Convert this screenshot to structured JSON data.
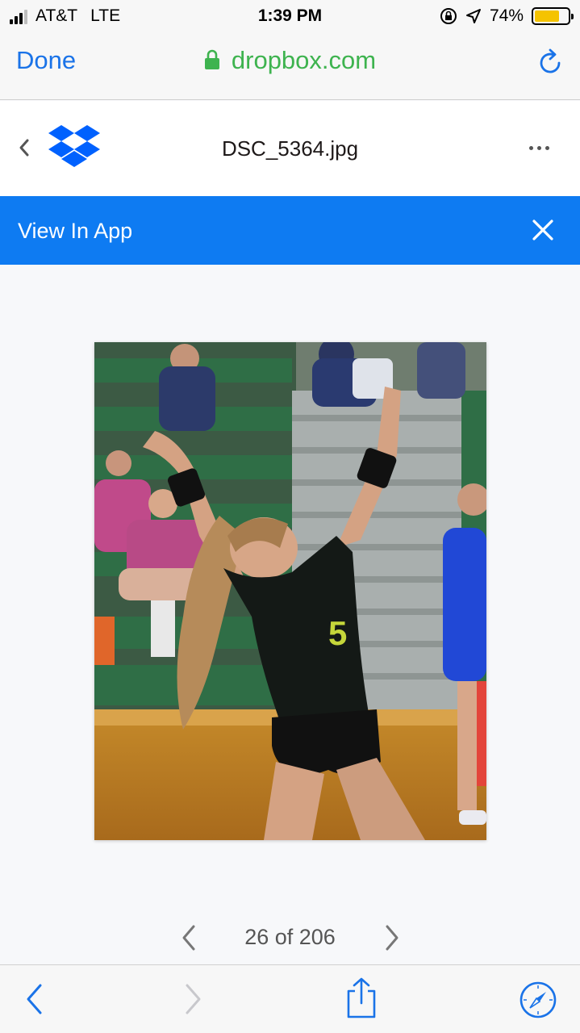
{
  "status_bar": {
    "carrier": "AT&T",
    "network": "LTE",
    "time": "1:39 PM",
    "battery_percent": "74%",
    "battery_level": 0.74,
    "icons": [
      "signal-icon",
      "orientation-lock-icon",
      "location-icon",
      "battery-icon"
    ]
  },
  "browser": {
    "done_label": "Done",
    "domain": "dropbox.com",
    "icons": [
      "lock-icon",
      "reload-icon"
    ]
  },
  "dropbox_header": {
    "filename": "DSC_5364.jpg",
    "icons": [
      "back-chevron-icon",
      "dropbox-logo-icon",
      "more-options-icon"
    ]
  },
  "banner": {
    "label": "View In App",
    "icons": [
      "close-icon"
    ],
    "color": "#0e7bf2"
  },
  "pager": {
    "count": "26 of 206",
    "icons": [
      "prev-chevron-icon",
      "next-chevron-icon"
    ]
  },
  "toolbar": {
    "icons": [
      "back-arrow-icon",
      "forward-arrow-icon",
      "share-icon",
      "compass-icon"
    ]
  },
  "colors": {
    "accent_blue": "#1a73e8",
    "secure_green": "#3eb34f",
    "battery_yellow": "#f5c300"
  }
}
